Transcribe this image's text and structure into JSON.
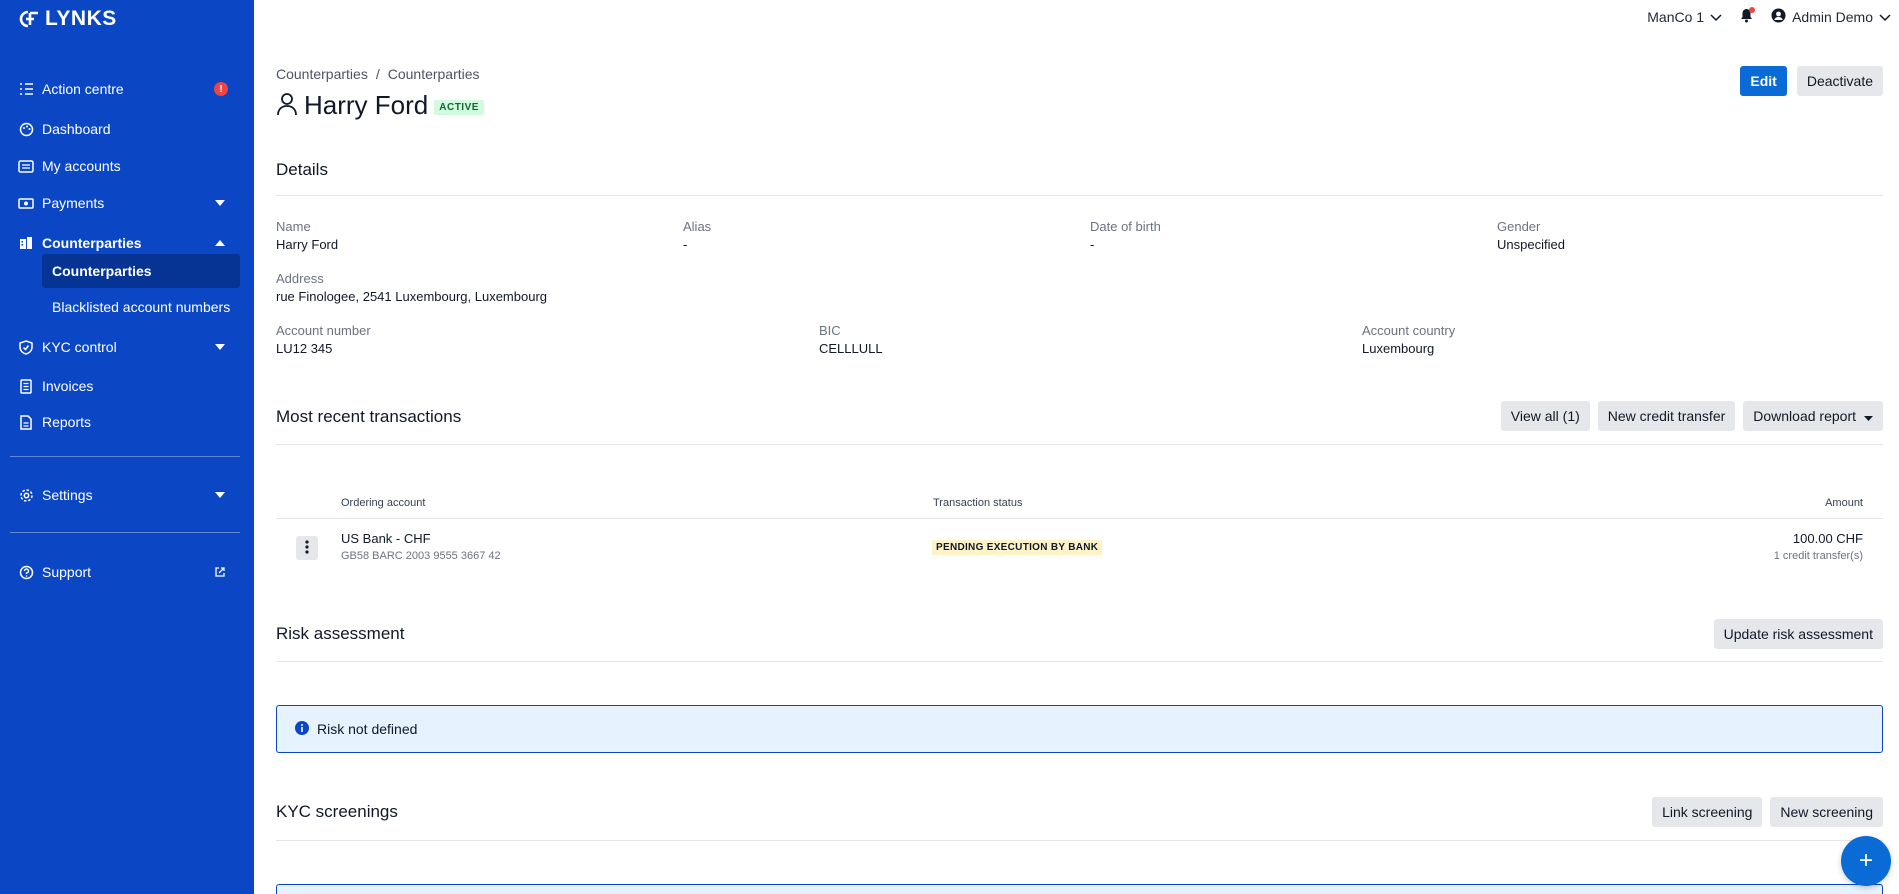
{
  "app": {
    "brand": "LYNKS"
  },
  "sidebar": {
    "items": [
      {
        "label": "Action centre",
        "badge": "!"
      },
      {
        "label": "Dashboard"
      },
      {
        "label": "My accounts"
      },
      {
        "label": "Payments"
      },
      {
        "label": "Counterparties"
      },
      {
        "label": "KYC control"
      },
      {
        "label": "Invoices"
      },
      {
        "label": "Reports"
      },
      {
        "label": "Settings"
      },
      {
        "label": "Support"
      }
    ],
    "subitems": [
      {
        "label": "Counterparties"
      },
      {
        "label": "Blacklisted account numbers"
      }
    ]
  },
  "topbar": {
    "company": "ManCo 1",
    "user": "Admin Demo"
  },
  "breadcrumb": {
    "first": "Counterparties",
    "separator": "/",
    "second": "Counterparties"
  },
  "header": {
    "title": "Harry Ford",
    "status": "ACTIVE",
    "edit_label": "Edit",
    "deactivate_label": "Deactivate"
  },
  "details": {
    "title": "Details",
    "name_label": "Name",
    "name": "Harry Ford",
    "alias_label": "Alias",
    "alias": "-",
    "dob_label": "Date of birth",
    "dob": "-",
    "gender_label": "Gender",
    "gender": "Unspecified",
    "address_label": "Address",
    "address": "rue Finologee, 2541 Luxembourg, Luxembourg",
    "account_label": "Account number",
    "account": "LU12 345",
    "bic_label": "BIC",
    "bic": "CELLLULL",
    "country_label": "Account country",
    "country": "Luxembourg"
  },
  "transactions": {
    "title": "Most recent transactions",
    "view_all": "View all (1)",
    "new_credit_transfer": "New credit transfer",
    "download_report": "Download report",
    "columns": {
      "ordering_account": "Ordering account",
      "status": "Transaction status",
      "amount": "Amount"
    },
    "rows": [
      {
        "account_name": "US Bank - CHF",
        "iban": "GB58 BARC 2003 9555 3667 42",
        "status": "PENDING EXECUTION BY BANK",
        "amount": "100.00 CHF",
        "count": "1 credit transfer(s)"
      }
    ]
  },
  "risk": {
    "title": "Risk assessment",
    "update_label": "Update risk assessment",
    "message": "Risk not defined"
  },
  "kyc": {
    "title": "KYC screenings",
    "link_label": "Link screening",
    "new_label": "New screening"
  },
  "fab": {
    "label": "+"
  },
  "colors": {
    "sidebar": "#0b47c4",
    "primary": "#0b6bd6",
    "active_sub": "#063495",
    "alert": "#ef4444"
  }
}
